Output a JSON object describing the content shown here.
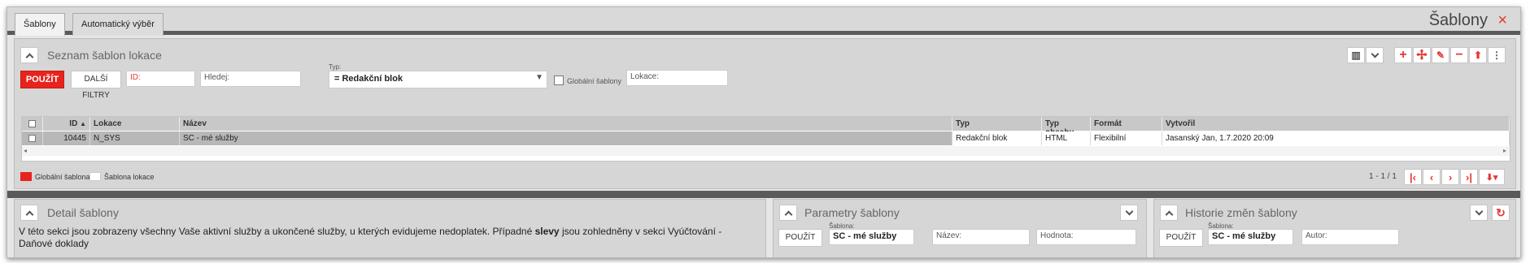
{
  "tabs": [
    {
      "label": "Šablony",
      "active": true
    },
    {
      "label": "Automatický výběr",
      "active": false
    }
  ],
  "window": {
    "title": "Šablony",
    "close_glyph": "×"
  },
  "list_panel": {
    "title": "Seznam šablon lokace",
    "apply_label": "POUŽÍT",
    "more_filters_label": "DALŠÍ FILTRY",
    "filters": {
      "id_placeholder": "ID:",
      "search_placeholder": "Hledej:",
      "type_label": "Typ:",
      "type_value": "= Redakční blok",
      "global_label": "Globální šablony",
      "location_placeholder": "Lokace:"
    },
    "toolbar_icons": [
      "columns-icon",
      "chevron-down-icon",
      "add-icon",
      "add-multiple-icon",
      "edit-icon",
      "remove-icon",
      "export-icon",
      "more-icon"
    ]
  },
  "grid": {
    "columns": [
      "ID",
      "Lokace",
      "Název",
      "Typ",
      "Typ obsahu",
      "Formát",
      "Vytvořil"
    ],
    "rows": [
      {
        "id": "10445",
        "location": "N_SYS",
        "name": "SC - mé služby",
        "type": "Redakční blok",
        "content_type": "HTML",
        "format": "Flexibilní",
        "created_by": "Jasanský Jan, 1.7.2020 20:09"
      }
    ]
  },
  "legend": {
    "global": "Globální šablona",
    "local": "Šablona lokace",
    "global_color": "#e8231e",
    "local_color": "#ffffff"
  },
  "pager": {
    "info": "1 - 1 / 1"
  },
  "detail_panel": {
    "title": "Detail šablony",
    "text_before": "V této sekci jsou zobrazeny všechny Vaše aktivní služby a ukončené služby, u kterých evidujeme nedoplatek. Případné ",
    "text_bold": "slevy",
    "text_after": "  jsou zohledněny v sekci Vyúčtování - Daňové doklady"
  },
  "params_panel": {
    "title": "Parametry šablony",
    "apply_label": "POUŽÍT",
    "template_label": "Šablona:",
    "template_value": "SC - mé služby",
    "name_placeholder": "Název:",
    "value_placeholder": "Hodnota:"
  },
  "history_panel": {
    "title": "Historie změn šablony",
    "apply_label": "POUŽÍT",
    "template_label": "Šablona:",
    "template_value": "SC - mé služby",
    "author_placeholder": "Autor:"
  }
}
